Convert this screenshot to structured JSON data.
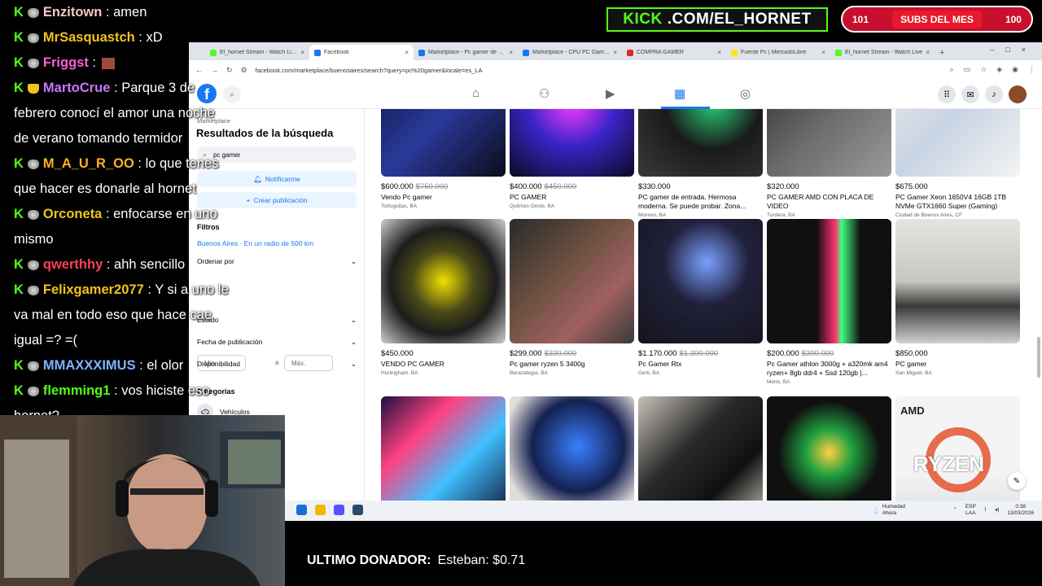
{
  "chat": [
    {
      "user": "Enzitown",
      "color": "#f2c9c9",
      "msg": "amen",
      "badge": "kick"
    },
    {
      "user": "MrSasquastch",
      "color": "#f0c419",
      "msg": "xD",
      "badge": "kick"
    },
    {
      "user": "Friggst",
      "color": "#ff5fd0",
      "msg": "",
      "badge": "kick"
    },
    {
      "user": "MartoCrue",
      "color": "#c977ff",
      "msg": "Parque 3 de",
      "badge": "trophy"
    },
    {
      "user": "",
      "color": "#fff",
      "msg": "febrero conocí el amor una noche",
      "badge": ""
    },
    {
      "user": "",
      "color": "#fff",
      "msg": "de verano tomando termidor",
      "badge": ""
    },
    {
      "user": "M_A_U_R_OO",
      "color": "#ffb21a",
      "msg": "lo que tenes",
      "badge": "kick"
    },
    {
      "user": "",
      "color": "#fff",
      "msg": "que hacer es donarle al hornet",
      "badge": ""
    },
    {
      "user": "Orconeta",
      "color": "#f0c419",
      "msg": "enfocarse en uno",
      "badge": "kick"
    },
    {
      "user": "",
      "color": "#fff",
      "msg": "mismo",
      "badge": ""
    },
    {
      "user": "qwerthhy",
      "color": "#ff3f5a",
      "msg": "ahh sencillo",
      "badge": "kick"
    },
    {
      "user": "Felixgamer2077",
      "color": "#f0c419",
      "msg": "Y si a uno le",
      "badge": "kick"
    },
    {
      "user": "",
      "color": "#fff",
      "msg": "va mal en todo eso que hace cae",
      "badge": ""
    },
    {
      "user": "",
      "color": "#fff",
      "msg": "igual =? =(",
      "badge": ""
    },
    {
      "user": "MMAXXXIMUS",
      "color": "#7fb4ff",
      "msg": "el olor",
      "badge": "kick"
    },
    {
      "user": "flemming1",
      "color": "#53fc18",
      "msg": "vos hiciste eso",
      "badge": "kick"
    },
    {
      "user": "",
      "color": "#fff",
      "msg": "hornet?",
      "badge": ""
    }
  ],
  "overlay": {
    "kick_prefix": "KICK",
    "kick_rest": ".COM/EL_HORNET",
    "subs_left": "101",
    "subs_label": "SUBS DEL MES",
    "subs_right": "100",
    "donor_label": "ULTIMO DONADOR:",
    "donor_value": "Esteban: $0.71"
  },
  "browser": {
    "tabs": [
      {
        "title": "El_hornet Stream - Watch Live on ...",
        "fav": "#53fc18",
        "active": false
      },
      {
        "title": "Facebook",
        "fav": "#1877f2",
        "active": true
      },
      {
        "title": "Marketplace - Pc gamer de entrada ...",
        "fav": "#1877f2",
        "active": false
      },
      {
        "title": "Marketplace - CPU PC Gamer Ryzen ...",
        "fav": "#1877f2",
        "active": false
      },
      {
        "title": "COMPRA GAMER",
        "fav": "#e02a2a",
        "active": false
      },
      {
        "title": "Fuente Pc | MercadoLibre",
        "fav": "#ffe600",
        "active": false
      },
      {
        "title": "El_hornet Stream - Watch Live",
        "fav": "#53fc18",
        "active": false
      }
    ],
    "url": "facebook.com/marketplace/buenosaires/search?query=pc%20gamer&locale=es_LA"
  },
  "sidebar": {
    "section": "Marketplace",
    "title": "Resultados de la búsqueda",
    "search_value": "pc gamer",
    "notify": "Notificarme",
    "create": "Crear publicación",
    "filters": "Filtros",
    "location": "Buenos Aires · En un radio de 500 km",
    "sort": "Ordenar por",
    "min": "Mín.",
    "sep": "a",
    "max": "Máx.",
    "condition": "Estado",
    "date": "Fecha de publicación",
    "availability": "Disponibilidad",
    "categories": "Categorías",
    "cat1": "Vehículos"
  },
  "listings": [
    {
      "price": "$600.000",
      "old": "$750.000",
      "title": "Vendo Pc gamer",
      "loc": "Tortuguitas, BA",
      "img": "linear-gradient(135deg,#0a0f3a,#2a3a9a 50%,#0b0b1a)"
    },
    {
      "price": "$400.000",
      "old": "$450.000",
      "title": "PC GAMER",
      "loc": "Quilmes Oeste, BA",
      "img": "radial-gradient(circle at 50% 40%,#ff3aff,#3a24c8 45%,#0a0a20)"
    },
    {
      "price": "$330.000",
      "old": "",
      "title": "PC gamer de entrada. Hermosa moderna. Se puede probar. Zona...",
      "loc": "Moreno, BA",
      "img": "radial-gradient(circle at 60% 40%,#27d37a,#1a1a1a 45%,#3a3a3a)"
    },
    {
      "price": "$320.000",
      "old": "",
      "title": "PC GAMER AMD CON PLACA DE VIDEO",
      "loc": "Turdera, BA",
      "img": "linear-gradient(135deg,#2a2a2a,#6a6a6a 50%,#9a9a9a)"
    },
    {
      "price": "$675.000",
      "old": "",
      "title": "PC Gamer Xeon 1650V4 16GB 1TB NVMe GTX1660 Super (Gaming)",
      "loc": "Ciudad de Buenos Aires, CF",
      "img": "linear-gradient(135deg,#e8e8e8,#c8d4e4 50%,#f4f4f4)"
    },
    {
      "price": "$450.000",
      "old": "",
      "title": "VENDO PC GAMER",
      "loc": "Hurlingham, BA",
      "img": "radial-gradient(circle at 50% 50%,#f2e000,#4a4a18 35%,#1c1c1c 60%,#cfcfcf)"
    },
    {
      "price": "$299.000",
      "old": "$330.000",
      "title": "Pc gamer ryzen 5 3400g",
      "loc": "Berazategui, BA",
      "img": "linear-gradient(135deg,#2a2a2a,#6a5040 40%,#a06060 70%,#3a3a3a)"
    },
    {
      "price": "$1.170.000",
      "old": "$1.300.000",
      "title": "Pc Gamer Rtx",
      "loc": "Gerli, BA",
      "img": "radial-gradient(circle at 55% 35%,#7aa0ff,#20203a 40%,#14141c)"
    },
    {
      "price": "$200.000",
      "old": "$300.000",
      "title": "Pc Gamer athlon 3000g + a320mk am4 ryzen+ 8gb ddr4 + Ssd 120gb |...",
      "loc": "Merlo, BA",
      "img": "linear-gradient(90deg,#101010 40%,#ff3070 55%,#40ff80 60%,#101010 75%)"
    },
    {
      "price": "$850.000",
      "old": "",
      "title": "PC gamer",
      "loc": "San Miguel, BA",
      "img": "linear-gradient(180deg,#e6e4e0,#c8c6c0 50%,#3a3a3a 70%,#d0d0d0)"
    },
    {
      "price": "",
      "old": "",
      "title": "",
      "loc": "",
      "img": "linear-gradient(135deg,#1a1040,#ff4080 30%,#40c0ff 60%,#101030)"
    },
    {
      "price": "",
      "old": "",
      "title": "",
      "loc": "",
      "img": "radial-gradient(circle at 55% 40%,#3a80ff,#142050 45%,#e0dcd8 75%)"
    },
    {
      "price": "",
      "old": "",
      "title": "",
      "loc": "",
      "img": "linear-gradient(135deg,#c8c2b8,#2a2a2a 40%,#101010 70%,#c8c2b8)"
    },
    {
      "price": "",
      "old": "",
      "title": "",
      "loc": "",
      "img": "radial-gradient(circle at 50% 45%,#ffd040,#20a040 25%,#101010 55%)"
    },
    {
      "price": "",
      "old": "",
      "title": "",
      "loc": "",
      "img": "linear-gradient(180deg,#f4f4f4 60%,#e0e0e0)"
    }
  ],
  "amd_text": "AMD",
  "ryzen_text": "RYZEN",
  "taskbar": {
    "weather": "Humedad",
    "weather2": "Ahora",
    "lang": "ESP",
    "lang2": "LAA",
    "time": "0:38",
    "date": "13/03/2026"
  }
}
